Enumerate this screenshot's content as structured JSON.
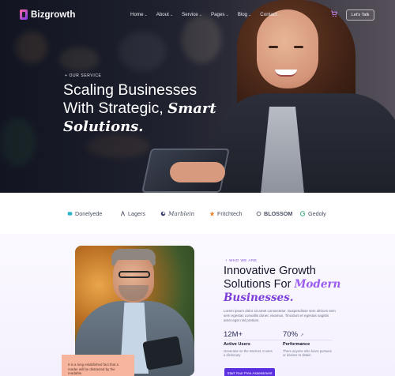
{
  "nav": {
    "logo": "Bizgrowth",
    "menu": [
      "Home",
      "About",
      "Service",
      "Pages",
      "Blog",
      "Contact"
    ],
    "cta": "Let's Talk"
  },
  "hero": {
    "eyebrow": "+ OUR SERVICE",
    "title_line1": "Scaling Businesses",
    "title_line2": "With Strategic,",
    "title_em1": "Smart",
    "title_em2": "Solutions."
  },
  "brands": [
    {
      "name": "Donelyede",
      "icon": "square-logo-icon",
      "color": "#2cb4c8"
    },
    {
      "name": "Lagers",
      "icon": "leaf-logo-icon",
      "color": "#4a4f63"
    },
    {
      "name": "Marblein",
      "icon": "swirl-logo-icon",
      "color": "#3a3f6e"
    },
    {
      "name": "Fritchtech",
      "icon": "star-logo-icon",
      "color": "#e98a3b"
    },
    {
      "name": "BLOSSOM",
      "icon": "blossom-logo-icon",
      "color": "#4a4f63"
    },
    {
      "name": "Gedoly",
      "icon": "g-logo-icon",
      "color": "#3fb07a"
    }
  ],
  "about": {
    "eyebrow": "+ WHO WE ARE",
    "title_line1": "Innovative Growth",
    "title_line2": "Solutions For",
    "title_em1": "Modern",
    "title_em2": "Businesses.",
    "description": "Lorem ipsum dolor sit amet consectetur. Suspendisse sem ultrices sem sem egestas convallis donec vivamus. Tincidunt et egestas sagittis amet eget nisl pretium.",
    "quote": "It is a long established fact that a reader will be distracted by the readable.",
    "stats": [
      {
        "value": "12M+",
        "label": "Active Users",
        "desc": "Generator on the Internet. It uses a dictionary"
      },
      {
        "value": "70%",
        "label": "Performance",
        "desc": "There anyone who loves pursues or desires to obtain"
      }
    ],
    "cta": "Start Your Free Assessment"
  },
  "colors": {
    "accent": "#5b2ee0",
    "italic_accent": "#9b5cf0"
  }
}
